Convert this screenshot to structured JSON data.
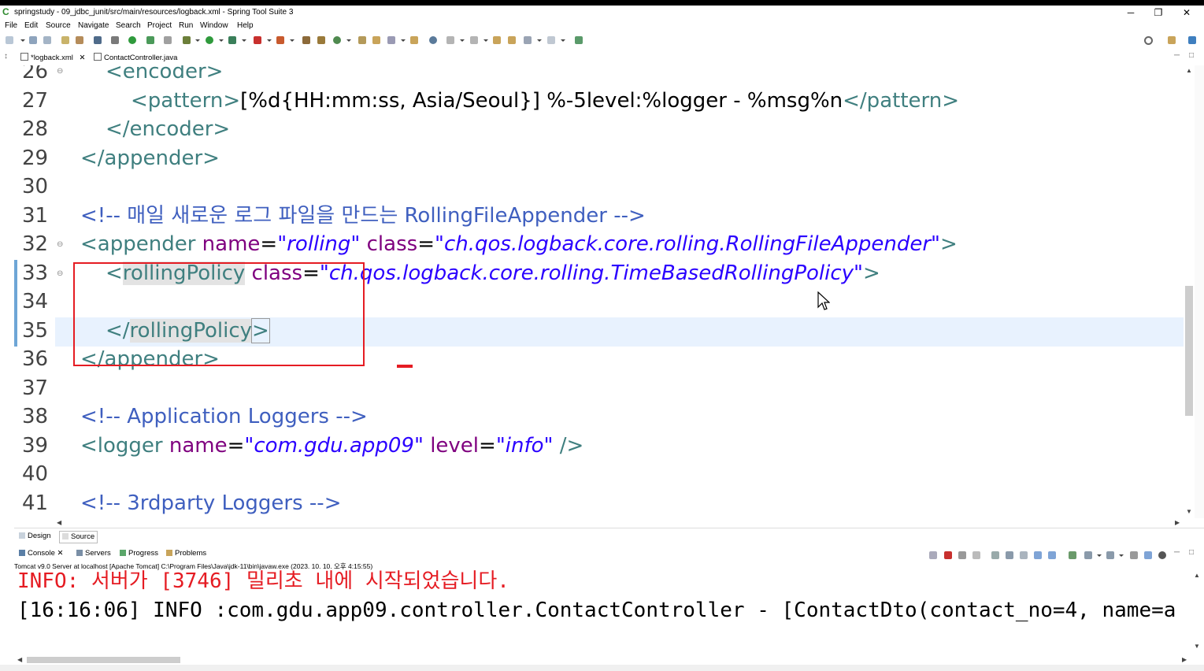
{
  "window": {
    "title": "springstudy - 09_jdbc_junit/src/main/resources/logback.xml - Spring Tool Suite 3",
    "controls": {
      "minimize": "─",
      "restore": "❐",
      "close": "✕"
    }
  },
  "menu": [
    "File",
    "Edit",
    "Source",
    "Navigate",
    "Search",
    "Project",
    "Run",
    "Window",
    "Help"
  ],
  "editor_tabs": [
    {
      "label": "*logback.xml",
      "close": "✕"
    },
    {
      "label": "ContactController.java"
    }
  ],
  "code_lines": [
    {
      "n": "26",
      "fold": "⊖"
    },
    {
      "n": "27"
    },
    {
      "n": "28"
    },
    {
      "n": "29"
    },
    {
      "n": "30"
    },
    {
      "n": "31"
    },
    {
      "n": "32",
      "fold": "⊖"
    },
    {
      "n": "33",
      "fold": "⊖"
    },
    {
      "n": "34"
    },
    {
      "n": "35"
    },
    {
      "n": "36"
    },
    {
      "n": "37"
    },
    {
      "n": "38"
    },
    {
      "n": "39"
    },
    {
      "n": "40"
    },
    {
      "n": "41"
    }
  ],
  "code": {
    "l26": {
      "open": "<encoder>"
    },
    "l27": {
      "open": "<pattern>",
      "text": "[%d{HH:mm:ss, Asia/Seoul}] %-5level:%logger - %msg%n",
      "close": "</pattern>"
    },
    "l28": {
      "close": "</encoder>"
    },
    "l29": {
      "close": "</appender>"
    },
    "l31": {
      "comment": "<!-- 매일 새로운 로그 파일을 만드는 RollingFileAppender -->"
    },
    "l32": {
      "lt": "<",
      "tag": "appender",
      "attr1": "name",
      "eq": "=",
      "val1": "\"rolling\"",
      "attr2": "class",
      "val2": "\"ch.qos.logback.core.rolling.RollingFileAppender\"",
      "gt": ">"
    },
    "l33": {
      "lt": "<",
      "tag": "rollingPolicy",
      "attr": "class",
      "eq": "=",
      "val": "\"ch.qos.logback.core.rolling.TimeBasedRollingPolicy\"",
      "gt": ">"
    },
    "l35": {
      "lt": "</",
      "tag": "rollingPolicy",
      "gt": ">"
    },
    "l36": {
      "close": "</appender>"
    },
    "l38": {
      "comment": "<!-- Application Loggers -->"
    },
    "l39": {
      "lt": "<",
      "tag": "logger",
      "attr1": "name",
      "eq": "=",
      "val1": "\"com.gdu.app09\"",
      "attr2": "level",
      "val2": "\"info\"",
      "end": " />"
    },
    "l41": {
      "comment": "<!-- 3rdparty Loggers -->"
    }
  },
  "design_tabs": [
    "Design",
    "Source"
  ],
  "console_tabs": [
    {
      "label": "Console",
      "close": "✕"
    },
    {
      "label": "Servers"
    },
    {
      "label": "Progress"
    },
    {
      "label": "Problems"
    }
  ],
  "console": {
    "process": "Tomcat v9.0 Server at localhost [Apache Tomcat] C:\\Program Files\\Java\\jdk-11\\bin\\javaw.exe  (2023. 10. 10. 오후 4:15:55)",
    "lines": [
      "INFO: 서버가 [3746] 밀리초 내에 시작되었습니다.",
      "[16:16:06] INFO :com.gdu.app09.controller.ContactController - [ContactDto(contact_no=4, name=a"
    ]
  },
  "colors": {
    "tag": "#3f7f7f",
    "attribute": "#7f007f",
    "value": "#2a00ff",
    "comment": "#3f5fbf",
    "annotation_red": "#e51c23",
    "console_error": "#e51c23"
  }
}
